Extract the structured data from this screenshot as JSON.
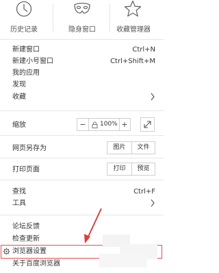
{
  "top": {
    "history_label": "历史记录",
    "incognito_label": "隐身窗口",
    "bookmarks_label": "收藏管理器"
  },
  "menu": {
    "new_window": {
      "label": "新建窗口",
      "shortcut": "Ctrl+N"
    },
    "new_small_window": {
      "label": "新建小号窗口",
      "shortcut": "Ctrl+Shift+M"
    },
    "my_apps": {
      "label": "我的应用"
    },
    "discover": {
      "label": "发现"
    },
    "favorites": {
      "label": "收藏"
    },
    "zoom": {
      "label": "缩放",
      "minus": "−",
      "value": "100%",
      "plus": "+"
    },
    "save_page_as": {
      "label": "网页另存为",
      "image": "图片",
      "file": "文件"
    },
    "print_page": {
      "label": "打印页面",
      "print": "打印",
      "preview": "预览"
    },
    "find": {
      "label": "查找",
      "shortcut": "Ctrl+F"
    },
    "tools": {
      "label": "工具"
    },
    "forum_feedback": {
      "label": "论坛反馈"
    },
    "check_update": {
      "label": "检查更新"
    },
    "browser_settings": {
      "label": "浏览器设置"
    },
    "about": {
      "label": "关于百度浏览器"
    }
  },
  "colors": {
    "highlight": "#e05050",
    "arrow": "#d94040"
  }
}
